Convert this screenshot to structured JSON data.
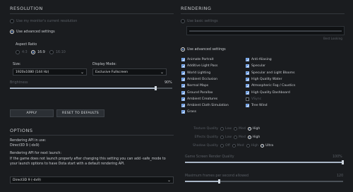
{
  "resolution": {
    "header": "RESOLUTION",
    "use_monitor_label": "Use my monitor's current resolution",
    "use_advanced_label": "Use advanced settings",
    "aspect_ratio_label": "Aspect Ratio",
    "aspect_options": [
      "4:3",
      "16:9",
      "16:10"
    ],
    "aspect_selected": "16:9",
    "size_label": "Size:",
    "size_value": "1920x1080 (144 Hz)",
    "display_mode_label": "Display Mode:",
    "display_mode_value": "Exclusive Fullscreen",
    "brightness_label": "Brightness",
    "brightness_value": "90%",
    "brightness_fraction": 0.9,
    "apply_label": "APPLY",
    "reset_label": "RESET TO DEFAULTS"
  },
  "options": {
    "header": "OPTIONS",
    "api_in_use_label": "Rendering API in use:",
    "api_in_use_value": "Direct3D 9 (-dx9)",
    "api_next_label": "Rendering API for next launch:",
    "api_note": "If the game does not launch properly after changing this setting you can add -safe_mode to your launch options to have Dota start with a default rendering API.",
    "api_select_value": "Direct3D 9 (-dx9)"
  },
  "rendering": {
    "header": "RENDERING",
    "use_basic_label": "Use basic settings",
    "basic_slider_end_label": "Best Looking",
    "use_advanced_label": "Use advanced settings",
    "checkboxes_left": [
      {
        "label": "Animate Portrait",
        "checked": true
      },
      {
        "label": "Additive Light Pass",
        "checked": true
      },
      {
        "label": "World Lighting",
        "checked": true
      },
      {
        "label": "Ambient Occlusion",
        "checked": true
      },
      {
        "label": "Normal Maps",
        "checked": true
      },
      {
        "label": "Ground Parallax",
        "checked": true
      },
      {
        "label": "Ambient Creatures",
        "checked": true
      },
      {
        "label": "Ambient Cloth Simulation",
        "checked": true
      },
      {
        "label": "Grass",
        "checked": true
      }
    ],
    "checkboxes_right": [
      {
        "label": "Anti-Aliasing",
        "checked": true
      },
      {
        "label": "Specular",
        "checked": true
      },
      {
        "label": "Specular and Light Blooms",
        "checked": true
      },
      {
        "label": "High Quality Water",
        "checked": true
      },
      {
        "label": "Atmospheric Fog / Caustics",
        "checked": true
      },
      {
        "label": "High Quality Dashboard",
        "checked": true
      },
      {
        "label": "VSync",
        "checked": false
      },
      {
        "label": "Tree Wind",
        "checked": true
      }
    ],
    "texture_quality_label": "Texture Quality",
    "texture_options": [
      "Low",
      "Med",
      "High"
    ],
    "texture_selected": "High",
    "effects_quality_label": "Effects Quality",
    "effects_options": [
      "Low",
      "Med",
      "High"
    ],
    "effects_selected": "High",
    "shadow_quality_label": "Shadow Quality",
    "shadow_options": [
      "Off",
      "Med",
      "High",
      "Ultra"
    ],
    "shadow_selected": "Ultra",
    "render_quality_label": "Game Screen Render Quality",
    "render_quality_value": "100%",
    "render_quality_fraction": 1.0,
    "max_fps_label": "Maximum frames per second allowed",
    "max_fps_value": "120",
    "max_fps_fraction": 0.22
  }
}
